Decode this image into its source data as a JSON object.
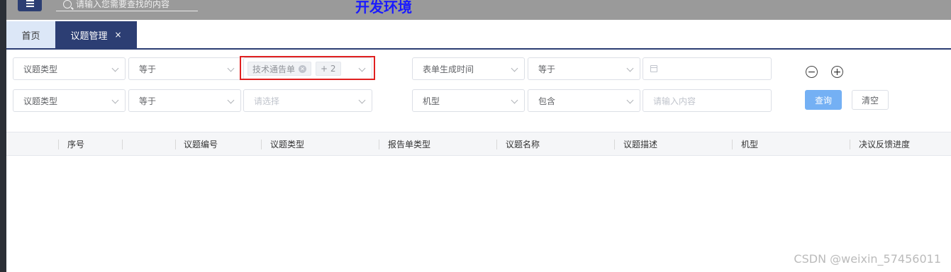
{
  "header": {
    "search_placeholder": "请输入您需要查找的内容",
    "env_title": "开发环境"
  },
  "tabs": [
    {
      "label": "首页"
    },
    {
      "label": "议题管理",
      "close": "×"
    }
  ],
  "filters": {
    "row1": {
      "field": "议题类型",
      "operator": "等于",
      "tag": "技术通告单",
      "more": "+ 2",
      "field2": "表单生成时间",
      "operator2": "等于"
    },
    "row2": {
      "field": "议题类型",
      "operator": "等于",
      "value_placeholder": "请选择",
      "field2": "机型",
      "operator2": "包含",
      "value2_placeholder": "请输入内容"
    }
  },
  "actions": {
    "remove_icon": "minus-circle-icon",
    "add_icon": "plus-circle-icon",
    "query": "查询",
    "clear": "清空"
  },
  "table": {
    "columns": [
      "序号",
      "议题编号",
      "议题类型",
      "报告单类型",
      "议题名称",
      "议题描述",
      "机型",
      "决议反馈进度"
    ]
  },
  "watermark": "CSDN @weixin_57456011"
}
